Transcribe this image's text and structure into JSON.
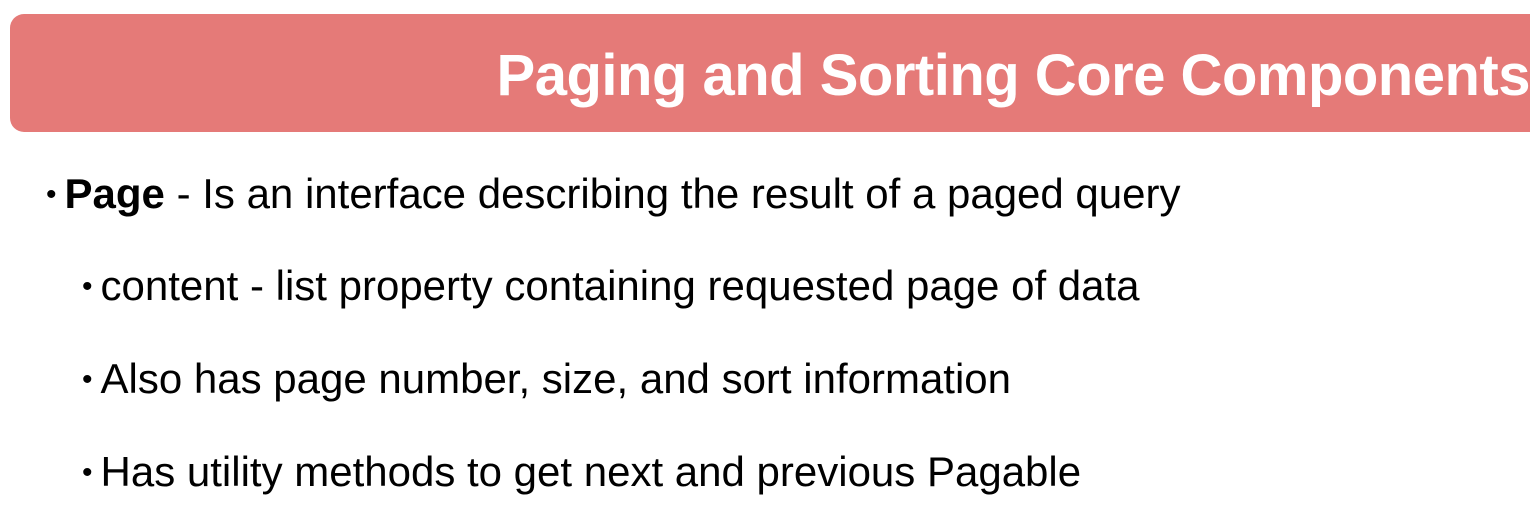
{
  "slide": {
    "title": "Paging and Sorting Core Components",
    "title_bar_color": "#e57a78",
    "bullets": [
      {
        "level": 1,
        "term": "Page",
        "text": " - Is an interface describing the result of a paged query"
      },
      {
        "level": 2,
        "text": "content - list property containing requested page of data"
      },
      {
        "level": 2,
        "text": "Also has page number, size, and sort information"
      },
      {
        "level": 2,
        "text": "Has utility methods to get next and previous Pagable"
      }
    ],
    "bullet_glyph": "•"
  }
}
